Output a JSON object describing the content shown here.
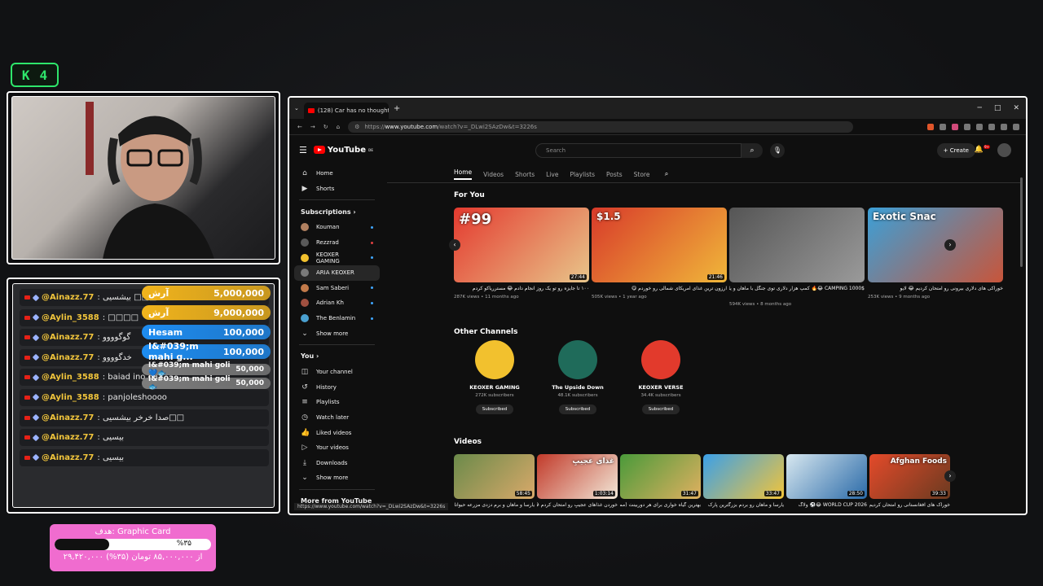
{
  "overlay": {
    "k_badge": {
      "letter": "K",
      "count": "4"
    },
    "chat": [
      {
        "user": "@Ainazz.77",
        "msg": ": بیشسیی □□□"
      },
      {
        "user": "@Aylin_3588",
        "msg": ": □□□□"
      },
      {
        "user": "@Ainazz.77",
        "msg": ": گوگوووو"
      },
      {
        "user": "@Ainazz.77",
        "msg": ": خدگوووو"
      },
      {
        "user": "@Aylin_3588",
        "msg": ": baiad ino qaz"
      },
      {
        "user": "@Aylin_3588",
        "msg": ": panjoleshoooo"
      },
      {
        "user": "@Ainazz.77",
        "msg": ": صدا خرخر بیشسیی□□"
      },
      {
        "user": "@Ainazz.77",
        "msg": ": بیسیی"
      },
      {
        "user": "@Ainazz.77",
        "msg": ": بیسیی"
      }
    ],
    "donations": [
      {
        "name": "آرش",
        "amount": "5,000,000",
        "color": "#f1b41d"
      },
      {
        "name": "آرش",
        "amount": "9,000,000",
        "color": "#f1b41d"
      },
      {
        "name": "Hesam",
        "amount": "100,000",
        "color": "#1e8cf0"
      },
      {
        "name": "I&#039;m mahi g...",
        "amount": "100,000",
        "color": "#1e8cf0"
      },
      {
        "name": "I&#039;m mahi goli 💙🐟",
        "amount": "50,000",
        "color": "#7d7d7d"
      },
      {
        "name": "I&#039;m mahi goli 🐟",
        "amount": "50,000",
        "color": "#7d7d7d"
      }
    ],
    "goal": {
      "title": "هدف: Graphic Card",
      "percent_label": "%۳۵",
      "progress": 0.35,
      "detail": "۲۹,۴۲۰,۰۰۰ از ۸۵,۰۰۰,۰۰۰ تومان (۳۵%)"
    }
  },
  "browser": {
    "tab_title": "(128) Car has no thought - You",
    "url_prefix": "https://",
    "url_host": "www.youtube.com",
    "url_path": "/watch?v=_DLwi2SAzDw&t=3226s",
    "status_url": "https://www.youtube.com/watch?v=_DLwi2SAzDw&t=3226s"
  },
  "youtube": {
    "logo": "YouTube",
    "logo_sup": "DE",
    "search_placeholder": "Search",
    "create_label": "Create",
    "bell_badge": "9+",
    "sidebar": {
      "top": [
        {
          "label": "Home",
          "icon": "home-icon"
        },
        {
          "label": "Shorts",
          "icon": "shorts-icon"
        }
      ],
      "subscriptions_heading": "Subscriptions",
      "subscriptions": [
        {
          "label": "Kouman",
          "color": "#b08060"
        },
        {
          "label": "Rezzrad",
          "color": "#5a5a5a"
        },
        {
          "label": "KEOXER GAMING",
          "color": "#f2c12e"
        },
        {
          "label": "ARIA KEOXER",
          "color": "#7a7a7a"
        },
        {
          "label": "Sam Saberi",
          "color": "#c27a4a"
        },
        {
          "label": "Adrian Kh",
          "color": "#a05040"
        },
        {
          "label": "The Benlamin",
          "color": "#4aa0d0"
        }
      ],
      "show_more": "Show more",
      "you_heading": "You",
      "you_items": [
        {
          "label": "Your channel",
          "icon": "channel-icon"
        },
        {
          "label": "History",
          "icon": "history-icon"
        },
        {
          "label": "Playlists",
          "icon": "playlists-icon"
        },
        {
          "label": "Watch later",
          "icon": "watch-later-icon"
        },
        {
          "label": "Liked videos",
          "icon": "like-icon"
        },
        {
          "label": "Your videos",
          "icon": "your-videos-icon"
        },
        {
          "label": "Downloads",
          "icon": "download-icon"
        },
        {
          "label": "Show more",
          "icon": "chevron-down-icon"
        }
      ],
      "more_from": "More from YouTube"
    },
    "channel_tabs": [
      "Home",
      "Videos",
      "Shorts",
      "Live",
      "Playlists",
      "Posts",
      "Store"
    ],
    "for_you_title": "For You",
    "for_you": [
      {
        "title": "۱۰۰ تا جایزه رو تو یک روز انجام دادم 😂 مسترریاکو کردم",
        "meta": "287K views • 11 months ago",
        "duration": "27:44",
        "colors": [
          "#e43a2f",
          "#e8c58a"
        ]
      },
      {
        "title": "ارزون ترین غذای آمریکای شمالی رو خوردم 😋",
        "meta": "505K views • 1 year ago",
        "duration": "21:46",
        "colors": [
          "#d83a2a",
          "#f0b73a"
        ]
      },
      {
        "title": "1000$ CAMPING 😂🔥 کمپ هزار دلاری توی جنگل با ماهان و یارسا",
        "meta": "594K views • 8 months ago",
        "duration": "",
        "colors": [
          "#555",
          "#9a9a9a"
        ]
      },
      {
        "title": "خوراکی های دلاری بیرونی رو امتحان کردیم 😂 لایو",
        "meta": "253K views • 9 months ago",
        "duration": "",
        "colors": [
          "#3ba0d8",
          "#c8553a"
        ]
      }
    ],
    "thumb_texts": [
      "#99",
      "$1.5",
      "",
      "Exotic Snac"
    ],
    "other_channels_title": "Other Channels",
    "other_channels": [
      {
        "name": "KEOXER GAMING",
        "subs": "272K subscribers",
        "button": "Subscribed",
        "color": "#f2c12e"
      },
      {
        "name": "The Upside Down",
        "subs": "48.1K subscribers",
        "button": "Subscribed",
        "color": "#1f6b5a"
      },
      {
        "name": "KEOXER VERSE",
        "subs": "34.4K subscribers",
        "button": "Subscribed",
        "color": "#e23a2c"
      }
    ],
    "videos_title": "Videos",
    "videos": [
      {
        "duration": "58:45",
        "title": "یارسا و ماهان و برم دزدی مزرعه حیوانات",
        "colors": [
          "#6b8a4a",
          "#d9a96a"
        ]
      },
      {
        "duration": "1:03:14",
        "title": "خوردن غذاهای عجیبِ رو امتحان کردم 😂 !!2",
        "colors": [
          "#c23a2a",
          "#f2e8d8"
        ]
      },
      {
        "duration": "31:47",
        "title": "بهترین گیاه خواری برای هر دوربینت (ممد",
        "colors": [
          "#4a9a3a",
          "#e0b060"
        ]
      },
      {
        "duration": "33:47",
        "title": "یارسا و ماهان رو بردم بزرگترین پارک",
        "colors": [
          "#3ba0e8",
          "#f2c43a"
        ]
      },
      {
        "duration": "28:50",
        "title": "WORLD CUP 2026 😂⚽ ولاگ",
        "colors": [
          "#d8e8f0",
          "#2a6aa8"
        ]
      },
      {
        "duration": "39:33",
        "title": "خوراک های افغانستانی رو امتحان کردیم",
        "colors": [
          "#e44a2a",
          "#6a3a20"
        ]
      }
    ],
    "video_overlay": [
      "",
      "غذای عجیبِ",
      "",
      "",
      "",
      "Afghan Foods"
    ]
  }
}
